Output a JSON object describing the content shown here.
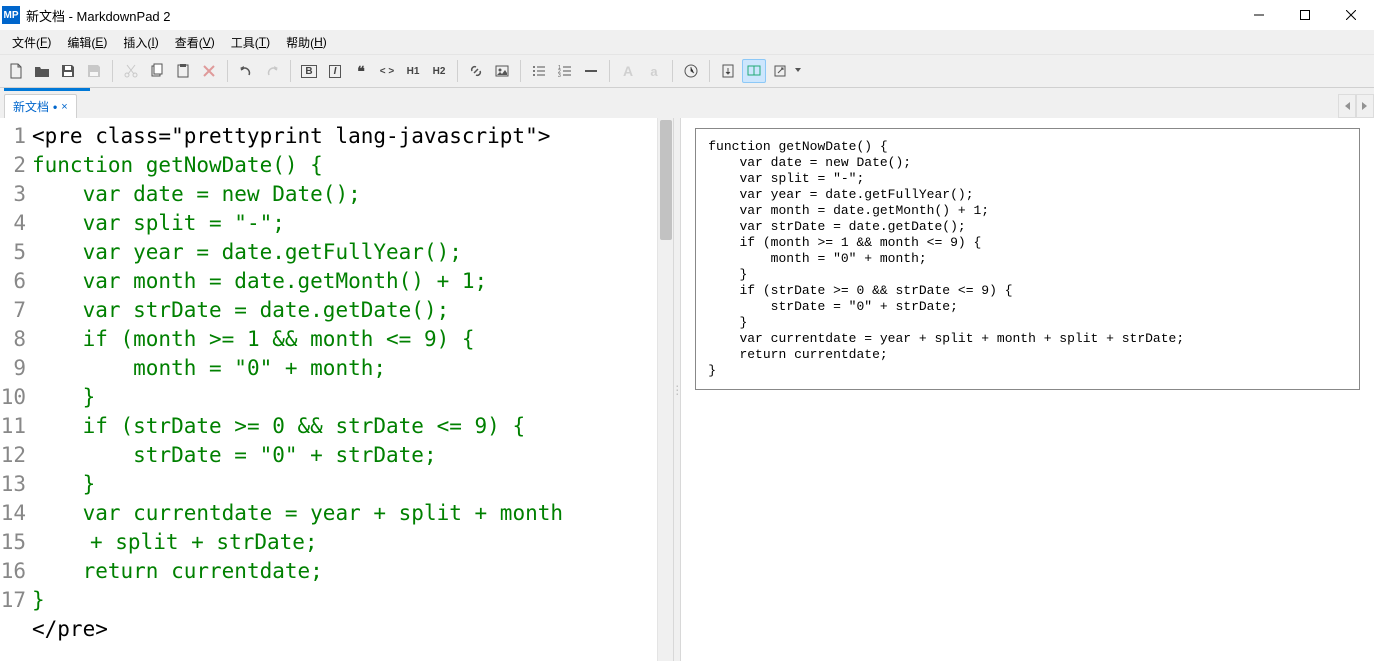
{
  "window": {
    "app_icon_text": "MP",
    "title": "新文档 - MarkdownPad 2"
  },
  "menu": {
    "file": {
      "label": "文件(",
      "accel": "F",
      "tail": ")"
    },
    "edit": {
      "label": "编辑(",
      "accel": "E",
      "tail": ")"
    },
    "insert": {
      "label": "插入(",
      "accel": "I",
      "tail": ")"
    },
    "view": {
      "label": "查看(",
      "accel": "V",
      "tail": ")"
    },
    "tools": {
      "label": "工具(",
      "accel": "T",
      "tail": ")"
    },
    "help": {
      "label": "帮助(",
      "accel": "H",
      "tail": ")"
    }
  },
  "toolbar": {
    "new": "new-file-icon",
    "open": "open-icon",
    "save": "save-icon",
    "saveall": "save-all-icon",
    "cut": "cut-icon",
    "copy": "copy-icon",
    "paste": "paste-icon",
    "delete": "delete-icon",
    "undo": "undo-icon",
    "redo": "redo-icon",
    "bold": "B",
    "italic": "I",
    "quote": "❝",
    "code": "< >",
    "h1": "H1",
    "h2": "H2",
    "link": "link-icon",
    "image": "image-icon",
    "ul": "ul-icon",
    "ol": "ol-icon",
    "hr": "hr-icon",
    "upper": "A",
    "lower": "a",
    "timestamp": "timestamp-icon",
    "export": "export-icon",
    "livepreview": "live-preview-icon",
    "openext": "open-external-icon"
  },
  "tabs": {
    "active": {
      "label": "新文档",
      "dirty": "•",
      "close": "×"
    }
  },
  "editor": {
    "gutter_lines": [
      "1",
      "2",
      "3",
      "4",
      "5",
      "6",
      "7",
      "8",
      "9",
      "10",
      "11",
      "12",
      "13",
      "14",
      "",
      "15",
      "16",
      "17"
    ],
    "lines": [
      {
        "cls": "black",
        "text": "<pre class=\"prettyprint lang-javascript\">"
      },
      {
        "cls": "green",
        "text": "function getNowDate() {"
      },
      {
        "cls": "green",
        "text": "    var date = new Date();"
      },
      {
        "cls": "green",
        "text": "    var split = \"-\";"
      },
      {
        "cls": "green",
        "text": "    var year = date.getFullYear();"
      },
      {
        "cls": "green",
        "text": "    var month = date.getMonth() + 1;"
      },
      {
        "cls": "green",
        "text": "    var strDate = date.getDate();"
      },
      {
        "cls": "green",
        "text": "    if (month >= 1 && month <= 9) {"
      },
      {
        "cls": "green",
        "text": "        month = \"0\" + month;"
      },
      {
        "cls": "green",
        "text": "    }"
      },
      {
        "cls": "green",
        "text": "    if (strDate >= 0 && strDate <= 9) {"
      },
      {
        "cls": "green",
        "text": "        strDate = \"0\" + strDate;"
      },
      {
        "cls": "green",
        "text": "    }"
      },
      {
        "cls": "green",
        "text": "    var currentdate = year + split + month"
      },
      {
        "cls": "green wrap",
        "text": "+ split + strDate;"
      },
      {
        "cls": "green",
        "text": "    return currentdate;"
      },
      {
        "cls": "green",
        "text": "}"
      },
      {
        "cls": "black",
        "text": "</pre>"
      }
    ]
  },
  "preview": {
    "content": "function getNowDate() {\n    var date = new Date();\n    var split = \"-\";\n    var year = date.getFullYear();\n    var month = date.getMonth() + 1;\n    var strDate = date.getDate();\n    if (month >= 1 && month <= 9) {\n        month = \"0\" + month;\n    }\n    if (strDate >= 0 && strDate <= 9) {\n        strDate = \"0\" + strDate;\n    }\n    var currentdate = year + split + month + split + strDate;\n    return currentdate;\n}"
  }
}
